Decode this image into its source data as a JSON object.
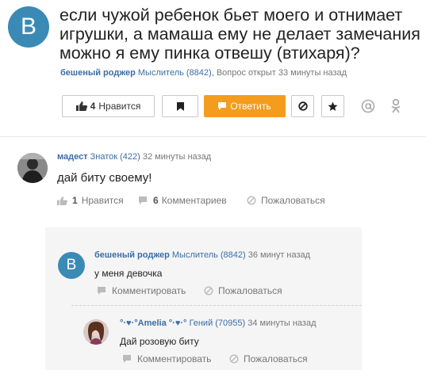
{
  "question": {
    "avatar_letter": "B",
    "title_line1": "если чужой ребенок бьет моего и отнимает",
    "title_line2": "игрушки, а мамаша ему не делает замечания",
    "title_line3": "можно я ему пинка отвешу (втихаря)?",
    "author": "бешеный роджер",
    "rank": "Мыслитель (8842),",
    "meta": "Вопрос открыт 33 минуты назад"
  },
  "toolbar": {
    "like_count": "4",
    "like_label": "Нравится",
    "answer_label": "Ответить"
  },
  "answer": {
    "author": "мадест",
    "rank": "Знаток (422)",
    "time": "32 минуты назад",
    "text": "дай биту своему!",
    "like_count": "1",
    "like_label": "Нравится",
    "comments_count": "6",
    "comments_label": "Комментариев",
    "report_label": "Пожаловаться"
  },
  "comments": [
    {
      "avatar_letter": "B",
      "author": "бешеный роджер",
      "rank": "Мыслитель (8842)",
      "time": "36 минут назад",
      "text": "у меня девочка",
      "comment_label": "Комментировать",
      "report_label": "Пожаловаться"
    },
    {
      "author": "°·♥·°Amelia °·♥·°",
      "rank": "Гений (70955)",
      "time": "34 минуты назад",
      "text": "Дай розовую биту",
      "comment_label": "Комментировать",
      "report_label": "Пожаловаться"
    }
  ],
  "colors": {
    "accent": "#3a8ab5",
    "link": "#3a6ea5",
    "answer_button": "#f39c1e"
  },
  "icons": [
    "thumbs-up-icon",
    "bookmark-icon",
    "reply-icon",
    "block-icon",
    "star-icon",
    "at-icon",
    "odnoklassniki-icon",
    "comment-icon",
    "report-icon"
  ]
}
